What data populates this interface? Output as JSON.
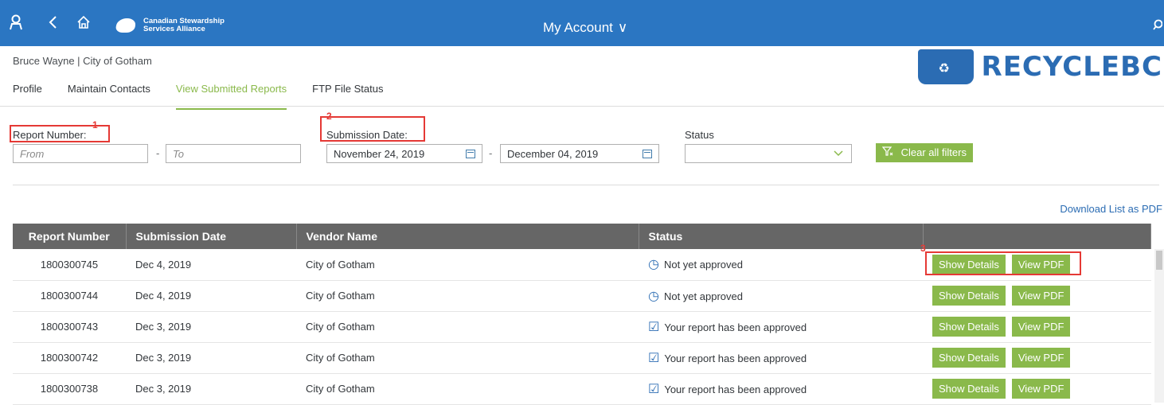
{
  "topbar": {
    "logo_line1": "Canadian Stewardship",
    "logo_line2": "Services Alliance",
    "title": "My Account",
    "chevron": "∨",
    "user_icon": "user-icon",
    "back_icon": "back-icon",
    "home_icon": "home-icon",
    "search_icon": "search-icon"
  },
  "user_line": "Bruce Wayne | City of Gotham",
  "brand": {
    "name": "RECYCLEBC"
  },
  "tabs": [
    {
      "label": "Profile"
    },
    {
      "label": "Maintain Contacts"
    },
    {
      "label": "View Submitted Reports"
    },
    {
      "label": "FTP File Status"
    }
  ],
  "filters": {
    "report_number_label": "Report Number:",
    "from_placeholder": "From",
    "to_placeholder": "To",
    "submission_date_label": "Submission Date:",
    "date_from": "November 24, 2019",
    "date_to": "December 04, 2019",
    "status_label": "Status",
    "clear_label": "Clear all filters",
    "dash": "-"
  },
  "annotations": {
    "a1": "1",
    "a2": "2",
    "a3": "3"
  },
  "download_label": "Download List as PDF",
  "table": {
    "headers": [
      "Report Number",
      "Submission Date",
      "Vendor Name",
      "Status",
      ""
    ],
    "show_details": "Show Details",
    "view_pdf": "View PDF",
    "rows": [
      {
        "number": "1800300745",
        "date": "Dec 4, 2019",
        "vendor": "City of Gotham",
        "status": "Not yet approved",
        "icon": "◷"
      },
      {
        "number": "1800300744",
        "date": "Dec 4, 2019",
        "vendor": "City of Gotham",
        "status": "Not yet approved",
        "icon": "◷"
      },
      {
        "number": "1800300743",
        "date": "Dec 3, 2019",
        "vendor": "City of Gotham",
        "status": "Your report has been approved",
        "icon": "☑"
      },
      {
        "number": "1800300742",
        "date": "Dec 3, 2019",
        "vendor": "City of Gotham",
        "status": "Your report has been approved",
        "icon": "☑"
      },
      {
        "number": "1800300738",
        "date": "Dec 3, 2019",
        "vendor": "City of Gotham",
        "status": "Your report has been approved",
        "icon": "☑"
      }
    ]
  },
  "colors": {
    "topbar": "#2b76c2",
    "accent_green": "#8ab94b",
    "table_header": "#666666",
    "annotation_red": "#e53935"
  }
}
